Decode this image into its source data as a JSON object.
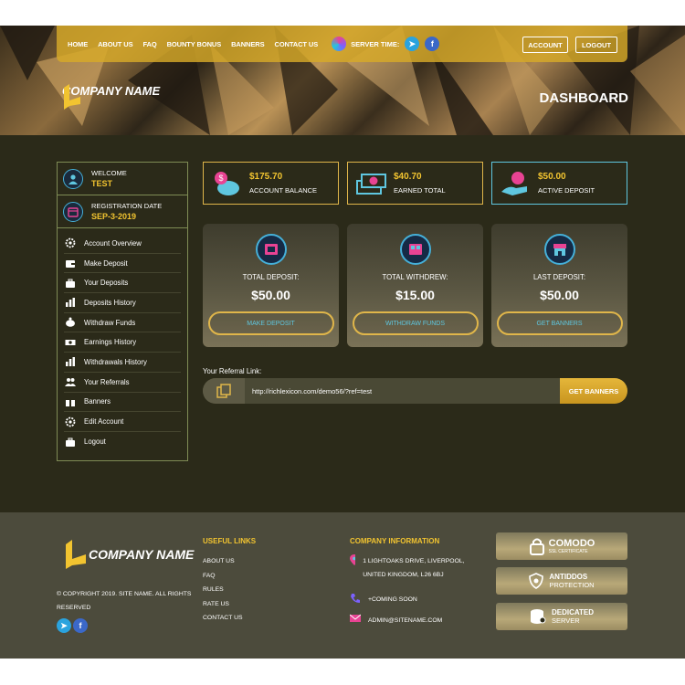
{
  "nav": {
    "links": [
      "HOME",
      "ABOUT US",
      "FAQ",
      "BOUNTY BONUS",
      "BANNERS",
      "CONTACT US"
    ],
    "server_time_label": "SERVER TIME:",
    "account_label": "ACCOUNT",
    "logout_label": "LOGOUT"
  },
  "hero": {
    "company_name": "COMPANY NAME",
    "page_title": "DASHBOARD"
  },
  "sidebar": {
    "welcome_label": "WELCOME",
    "username": "TEST",
    "registration_label": "REGISTRATION DATE",
    "registration_date": "SEP-3-2019",
    "items": [
      {
        "label": "Account Overview",
        "icon": "gear-icon"
      },
      {
        "label": "Make Deposit",
        "icon": "wallet-icon"
      },
      {
        "label": "Your Deposits",
        "icon": "briefcase-icon"
      },
      {
        "label": "Deposits History",
        "icon": "chart-icon"
      },
      {
        "label": "Withdraw Funds",
        "icon": "piggy-bank-icon"
      },
      {
        "label": "Earnings History",
        "icon": "cash-icon"
      },
      {
        "label": "Withdrawals History",
        "icon": "chart-icon"
      },
      {
        "label": "Your Referrals",
        "icon": "users-icon"
      },
      {
        "label": "Banners",
        "icon": "gift-icon"
      },
      {
        "label": "Edit Account",
        "icon": "gear-icon"
      },
      {
        "label": "Logout",
        "icon": "briefcase-icon"
      }
    ]
  },
  "stats": [
    {
      "value": "$175.70",
      "label": "ACCOUNT BALANCE",
      "icon": "piggy-bank-icon",
      "border": "#e0b64a"
    },
    {
      "value": "$40.70",
      "label": "EARNED TOTAL",
      "icon": "money-stack-icon",
      "border": "#e0b64a"
    },
    {
      "value": "$50.00",
      "label": "ACTIVE DEPOSIT",
      "icon": "hand-coin-icon",
      "border": "#5fc7e0"
    }
  ],
  "cards": [
    {
      "label": "TOTAL DEPOSIT:",
      "value": "$50.00",
      "button": "MAKE DEPOSIT",
      "icon": "deposit-icon"
    },
    {
      "label": "TOTAL WITHDREW:",
      "value": "$15.00",
      "button": "WITHDRAW FUNDS",
      "icon": "withdraw-icon"
    },
    {
      "label": "LAST DEPOSIT:",
      "value": "$50.00",
      "button": "GET BANNERS",
      "icon": "store-icon"
    }
  ],
  "referral": {
    "label": "Your Referral Link:",
    "url": "http://richlexicon.com/demo56/?ref=test",
    "button": "GET BANNERS"
  },
  "footer": {
    "company_name": "COMPANY NAME",
    "copyright": "© COPYRIGHT 2019. SITE NAME. ALL RIGHTS RESERVED",
    "useful_links_title": "USEFUL LINKS",
    "useful_links": [
      "ABOUT US",
      "FAQ",
      "RULES",
      "RATE US",
      "CONTACT US"
    ],
    "company_info_title": "COMPANY INFORMATION",
    "address": "1 LIGHTOAKS DRIVE, LIVERPOOL, UNITED KINGDOM, L26 6BJ",
    "phone": "+COMING SOON",
    "email": "ADMIN@SITENAME.COM",
    "badges": [
      {
        "line1": "COMODO",
        "line2": "SSL CERTIFICATE"
      },
      {
        "line1": "ANTIDDOS",
        "line2": "PROTECTION"
      },
      {
        "line1": "DEDICATED",
        "line2": "SERVER"
      }
    ]
  },
  "colors": {
    "accent_gold": "#f2c430",
    "accent_cyan": "#5fc7e0",
    "background": "#2b2a19",
    "footer": "#4c4b3c"
  }
}
